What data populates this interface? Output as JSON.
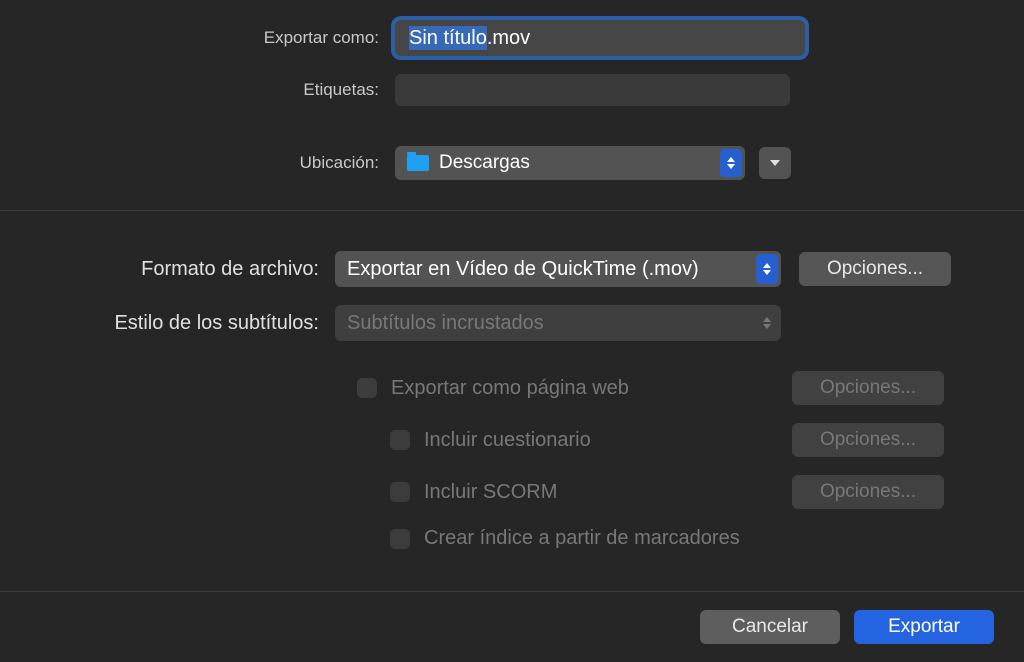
{
  "top": {
    "export_as_label": "Exportar como:",
    "filename_selected": "Sin título",
    "filename_ext": ".mov",
    "tags_label": "Etiquetas:",
    "location_label": "Ubicación:",
    "location_value": "Descargas"
  },
  "middle": {
    "format_label": "Formato de archivo:",
    "format_value": "Exportar en Vídeo de QuickTime (.mov)",
    "options_label": "Opciones...",
    "subtitle_label": "Estilo de los subtítulos:",
    "subtitle_value": "Subtítulos incrustados",
    "checkbox_web": "Exportar como página web",
    "checkbox_quiz": "Incluir cuestionario",
    "checkbox_scorm": "Incluir SCORM",
    "checkbox_bookmarks": "Crear índice a partir de marcadores"
  },
  "bottom": {
    "cancel": "Cancelar",
    "export": "Exportar"
  }
}
